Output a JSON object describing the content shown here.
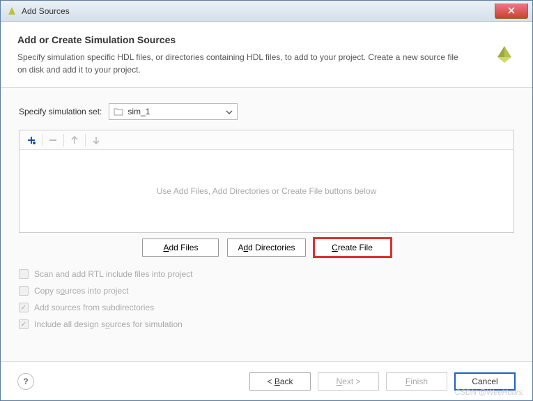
{
  "window": {
    "title": "Add Sources"
  },
  "header": {
    "title": "Add or Create Simulation Sources",
    "description": "Specify simulation specific HDL files, or directories containing HDL files, to add to your project. Create a new source file on disk and add it to your project."
  },
  "sim_set": {
    "label": "Specify simulation set:",
    "value": "sim_1"
  },
  "file_list": {
    "placeholder": "Use Add Files, Add Directories or Create File buttons below"
  },
  "buttons": {
    "add_files": "Add Files",
    "add_directories": "Add Directories",
    "create_file": "Create File"
  },
  "checkboxes": [
    {
      "label": "Scan and add RTL include files into project",
      "checked": false,
      "enabled": false
    },
    {
      "label": "Copy sources into project",
      "checked": false,
      "enabled": false
    },
    {
      "label": "Add sources from subdirectories",
      "checked": true,
      "enabled": false
    },
    {
      "label": "Include all design sources for simulation",
      "checked": true,
      "enabled": false
    }
  ],
  "footer": {
    "back": "< Back",
    "next": "Next >",
    "finish": "Finish",
    "cancel": "Cancel"
  },
  "watermark": "CSDN @WeeHours."
}
